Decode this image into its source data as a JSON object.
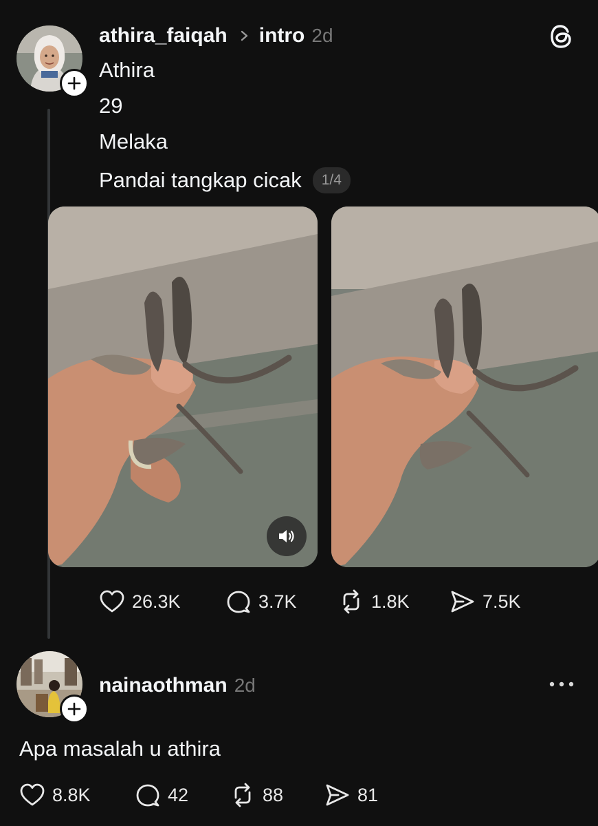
{
  "post": {
    "username": "athira_faiqah",
    "topic": "intro",
    "time": "2d",
    "lines": [
      "Athira",
      "29",
      "Melaka",
      "Pandai tangkap cicak"
    ],
    "carousel_counter": "1/4",
    "stats": {
      "likes": "26.3K",
      "replies": "3.7K",
      "reposts": "1.8K",
      "shares": "7.5K"
    }
  },
  "reply": {
    "username": "nainaothman",
    "time": "2d",
    "text": "Apa masalah u athira",
    "stats": {
      "likes": "8.8K",
      "replies": "42",
      "reposts": "88",
      "shares": "81"
    }
  },
  "icons": {
    "app_logo": "threads-logo-icon",
    "follow": "plus-icon",
    "topic_separator": "chevron-right-icon",
    "sound": "speaker-icon",
    "more": "more-horizontal-icon",
    "like": "heart-icon",
    "reply": "comment-icon",
    "repost": "repost-icon",
    "share": "send-icon"
  },
  "colors": {
    "background": "#101010",
    "text": "#f3f5f7",
    "muted": "#777777"
  }
}
